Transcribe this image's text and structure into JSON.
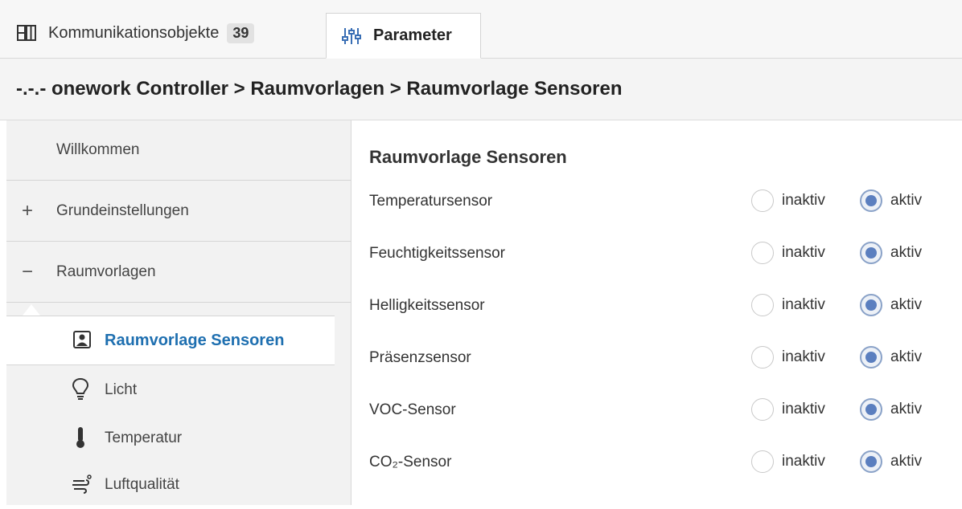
{
  "tabs": {
    "kommunikation": {
      "label": "Kommunikationsobjekte",
      "count": "39",
      "icon": "grid-icon"
    },
    "parameter": {
      "label": "Parameter",
      "icon": "sliders-icon",
      "selected": true
    }
  },
  "breadcrumb": "-.-.- onework Controller > Raumvorlagen > Raumvorlage Sensoren",
  "sidebar": {
    "items": [
      {
        "label": "Willkommen",
        "sign": ""
      },
      {
        "label": "Grundeinstellungen",
        "sign": "+"
      },
      {
        "label": "Raumvorlagen",
        "sign": "−"
      }
    ],
    "sub": [
      {
        "label": "Raumvorlage Sensoren",
        "icon": "sensor-icon",
        "active": true
      },
      {
        "label": "Licht",
        "icon": "bulb-icon"
      },
      {
        "label": "Temperatur",
        "icon": "thermometer-icon"
      },
      {
        "label": "Luftqualität",
        "icon": "air-quality-icon"
      }
    ]
  },
  "main": {
    "title": "Raumvorlage Sensoren",
    "option_inaktiv": "inaktiv",
    "option_aktiv": "aktiv",
    "rows": [
      {
        "name": "Temperatursensor",
        "value": "aktiv"
      },
      {
        "name": "Feuchtigkeitssensor",
        "value": "aktiv"
      },
      {
        "name": "Helligkeitssensor",
        "value": "aktiv"
      },
      {
        "name": "Präsenzsensor",
        "value": "aktiv"
      },
      {
        "name": "VOC-Sensor",
        "value": "aktiv"
      },
      {
        "name": "CO₂-Sensor",
        "value": "aktiv"
      }
    ]
  },
  "colors": {
    "accent": "#1e6fb0",
    "radio_selected": "#5b7fbf"
  }
}
